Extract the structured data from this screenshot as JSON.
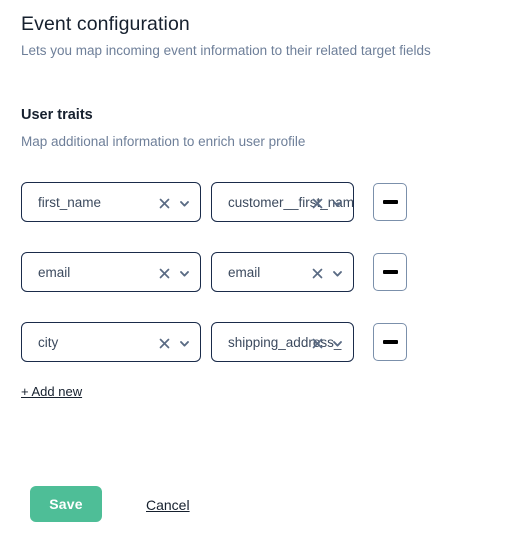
{
  "header": {
    "title": "Event configuration",
    "subtitle": "Lets you map incoming event information to their related target fields"
  },
  "section": {
    "title": "User traits",
    "subtitle": "Map additional information to enrich user profile"
  },
  "mappings": {
    "add_new_label": "+ Add new",
    "rows": [
      {
        "source": "first_name",
        "target": "customer__first_nam",
        "clear_icon": "close-icon",
        "chevron_icon": "chevron-down-icon",
        "remove_icon": "minus-icon"
      },
      {
        "source": "email",
        "target": "email",
        "clear_icon": "close-icon",
        "chevron_icon": "chevron-down-icon",
        "remove_icon": "minus-icon"
      },
      {
        "source": "city",
        "target": "shipping_address_",
        "clear_icon": "close-icon",
        "chevron_icon": "chevron-down-icon",
        "remove_icon": "minus-icon"
      }
    ]
  },
  "footer": {
    "save_label": "Save",
    "cancel_label": "Cancel"
  },
  "colors": {
    "accent_green": "#4ebe97",
    "field_border": "#1a2b4a",
    "muted_text": "#6e7f99",
    "icon_slate": "#5a6b84"
  }
}
